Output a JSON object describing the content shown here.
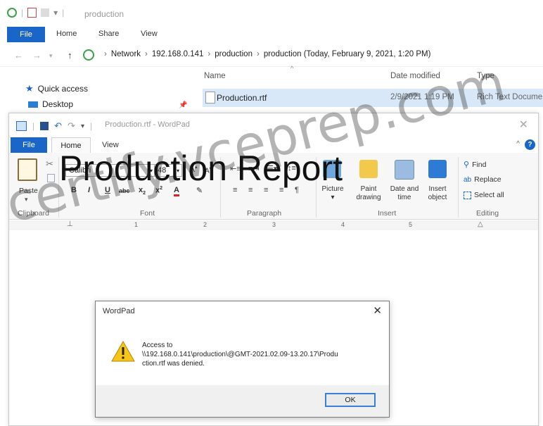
{
  "explorer": {
    "title": "production",
    "ribbon_tabs": {
      "file": "File",
      "home": "Home",
      "share": "Share",
      "view": "View"
    },
    "breadcrumbs": [
      "Network",
      "192.168.0.141",
      "production",
      "production (Today, February 9, 2021, 1:20 PM)"
    ],
    "columns": {
      "name": "Name",
      "date": "Date modified",
      "type": "Type"
    },
    "files": [
      {
        "name": "Production.rtf",
        "date": "2/9/2021 1:19 PM",
        "type": "Rich Text Docume"
      }
    ],
    "sidebar": {
      "quick_access": "Quick access",
      "desktop": "Desktop"
    }
  },
  "wordpad": {
    "title": "Production.rtf - WordPad",
    "tabs": {
      "file": "File",
      "home": "Home",
      "view": "View"
    },
    "clipboard": {
      "paste": "Paste",
      "label": "Clipboard"
    },
    "font": {
      "family": "Calibri",
      "size": "48",
      "label": "Font"
    },
    "paragraph": {
      "label": "Paragraph"
    },
    "insert": {
      "picture": "Picture",
      "paint_line1": "Paint",
      "paint_line2": "drawing",
      "date_line1": "Date and",
      "date_line2": "time",
      "object_line1": "Insert",
      "object_line2": "object",
      "label": "Insert"
    },
    "editing": {
      "find": "Find",
      "replace": "Replace",
      "select_all": "Select all",
      "label": "Editing"
    },
    "ruler_marks": [
      "1",
      "2",
      "3",
      "4",
      "5"
    ],
    "document_text": "Production Report"
  },
  "dialog": {
    "title": "WordPad",
    "message_line1": "Access to",
    "message_line2": "\\\\192.168.0.141\\production\\@GMT-2021.02.09-13.20.17\\Produ",
    "message_line3": "ction.rtf was denied.",
    "ok": "OK"
  },
  "watermark": "certify.vceprep.com",
  "colors": {
    "accent": "#1a66c8",
    "selected_row": "#d8e8f8",
    "warning": "#f5c518"
  }
}
